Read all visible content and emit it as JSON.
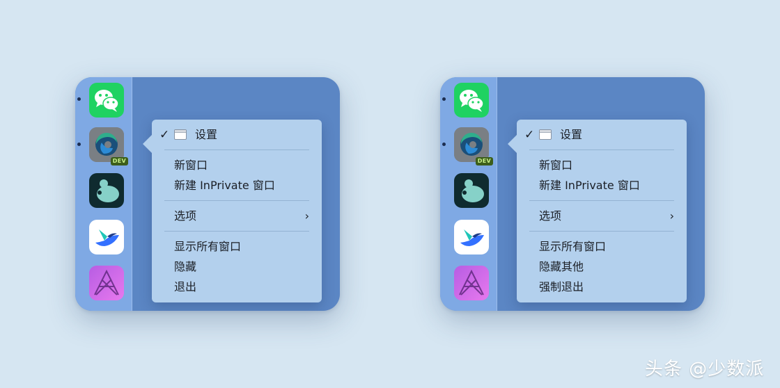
{
  "dock": {
    "apps": [
      {
        "name": "WeChat",
        "icon": "wechat-icon",
        "running": true
      },
      {
        "name": "Microsoft Edge Dev",
        "icon": "edge-dev-icon",
        "running": true,
        "badge": "DEV"
      },
      {
        "name": "Camo",
        "icon": "camo-icon",
        "running": false
      },
      {
        "name": "Feishu",
        "icon": "feishu-icon",
        "running": false
      },
      {
        "name": "Affinity Photo",
        "icon": "affinity-photo-icon",
        "running": false
      }
    ]
  },
  "left_menu": {
    "settings": "设置",
    "new_window": "新窗口",
    "new_inprivate": "新建 InPrivate 窗口",
    "options": "选项",
    "show_all_windows": "显示所有窗口",
    "hide": "隐藏",
    "quit": "退出"
  },
  "right_menu": {
    "settings": "设置",
    "new_window": "新窗口",
    "new_inprivate": "新建 InPrivate 窗口",
    "options": "选项",
    "show_all_windows": "显示所有窗口",
    "hide_others": "隐藏其他",
    "force_quit": "强制退出"
  },
  "glyphs": {
    "check": "✓",
    "chevron": "›"
  },
  "watermark": "头条 @少数派",
  "colors": {
    "background": "#d6e6f2",
    "panel": "#5b86c4",
    "dock": "#7fa9e4",
    "menu": "#b3d0ed",
    "dev_badge": "#3c5e1a"
  }
}
